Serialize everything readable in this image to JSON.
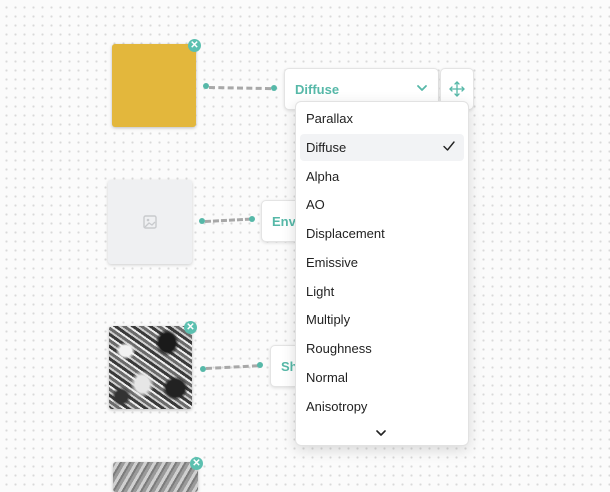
{
  "accent_color": "#56b8a8",
  "map_select": {
    "selected": "Diffuse",
    "options": [
      "Parallax",
      "Diffuse",
      "Alpha",
      "AO",
      "Displacement",
      "Emissive",
      "Light",
      "Multiply",
      "Roughness",
      "Normal",
      "Anisotropy"
    ]
  },
  "nodes": {
    "env_label": "Environment",
    "sh_label": "Sheen"
  },
  "icons": {
    "close": "close-icon",
    "chevron": "chevron-down-icon",
    "move": "move-icon",
    "check": "checkmark-icon",
    "image_placeholder": "image-placeholder-icon",
    "scroll_more": "chevron-down-icon"
  }
}
